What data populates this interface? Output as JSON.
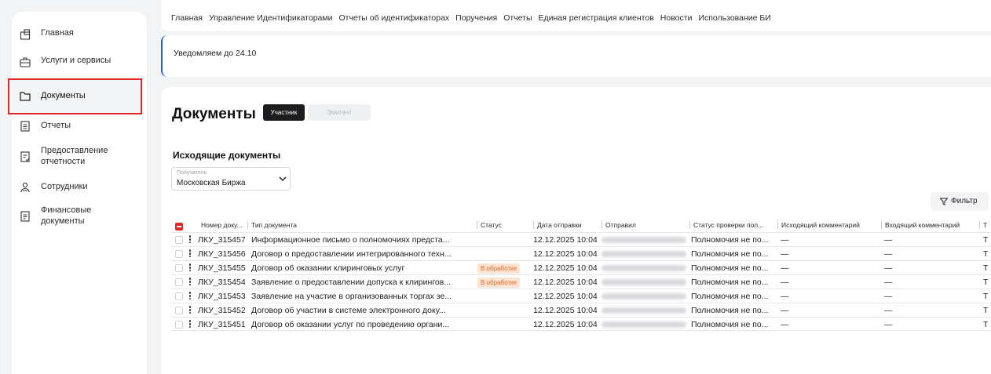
{
  "sidebar": {
    "items": [
      {
        "label": "Главная",
        "icon": "home-icon"
      },
      {
        "label": "Услуги и сервисы",
        "icon": "briefcase-icon"
      },
      {
        "label": "Документы",
        "icon": "folder-icon",
        "active": true
      },
      {
        "label": "Отчеты",
        "icon": "report-icon"
      },
      {
        "label": "Предоставление отчетности",
        "icon": "report-submit-icon"
      },
      {
        "label": "Сотрудники",
        "icon": "employees-icon"
      },
      {
        "label": "Финансовые документы",
        "icon": "financial-doc-icon"
      }
    ]
  },
  "topnav": {
    "links": [
      "Главная",
      "Управление Идентификаторами",
      "Отчеты об идентификаторах",
      "Поручения",
      "Отчеты",
      "Единая регистрация клиентов",
      "Новости",
      "Использование БИ"
    ]
  },
  "notice": {
    "text": "Уведомляем до 24.10"
  },
  "page": {
    "title": "Документы",
    "tabs": [
      {
        "label": "Участник",
        "active": true
      },
      {
        "label": "Эмитент",
        "active": false
      }
    ],
    "section_title": "Исходящие документы",
    "recipient": {
      "caption": "Получатель",
      "value": "Московская Биржа"
    },
    "filter_label": "Фильтр"
  },
  "table": {
    "columns": [
      "Номер доку...",
      "Тип документа",
      "Статус",
      "Дата отправки",
      "Отправил",
      "Статус проверки пол...",
      "Исходящий комментарий",
      "Входящий комментарий",
      "Т"
    ],
    "rows": [
      {
        "num": "ЛКУ_315457",
        "type": "Информационное письмо о полномочиях предста...",
        "status": "",
        "date": "12.12.2025 10:04",
        "check": "Полномочия не по...",
        "out_comment": "—",
        "in_comment": "—",
        "t": "Т"
      },
      {
        "num": "ЛКУ_315456",
        "type": "Договор о предоставлении интегрированного техн...",
        "status": "",
        "date": "12.12.2025 10:04",
        "check": "Полномочия не по...",
        "out_comment": "—",
        "in_comment": "—",
        "t": "Т"
      },
      {
        "num": "ЛКУ_315455",
        "type": "Договор об оказании клиринговых услуг",
        "status": "В обработке",
        "date": "12.12.2025 10:04",
        "check": "Полномочия не по...",
        "out_comment": "—",
        "in_comment": "—",
        "t": "Т"
      },
      {
        "num": "ЛКУ_315454",
        "type": "Заявление о предоставлении допуска к клирингов...",
        "status": "В обработке",
        "date": "12.12.2025 10:04",
        "check": "Полномочия не по...",
        "out_comment": "—",
        "in_comment": "—",
        "t": "Т"
      },
      {
        "num": "ЛКУ_315453",
        "type": "Заявление на участие в организованных торгах зе...",
        "status": "",
        "date": "12.12.2025 10:04",
        "check": "Полномочия не по...",
        "out_comment": "—",
        "in_comment": "—",
        "t": "Т"
      },
      {
        "num": "ЛКУ_315452",
        "type": "Договор об участии в системе электронного доку...",
        "status": "",
        "date": "12.12.2025 10:04",
        "check": "Полномочия не по...",
        "out_comment": "—",
        "in_comment": "—",
        "t": "Т"
      },
      {
        "num": "ЛКУ_315451",
        "type": "Договор об оказании услуг по проведению органи...",
        "status": "",
        "date": "12.12.2025 10:04",
        "check": "Полномочия не по...",
        "out_comment": "—",
        "in_comment": "—",
        "t": "Т"
      }
    ]
  },
  "colors": {
    "accent": "#e2262a",
    "notice_border": "#2d5bd0",
    "badge_bg": "#fbe3d0",
    "badge_text": "#d9682a"
  }
}
